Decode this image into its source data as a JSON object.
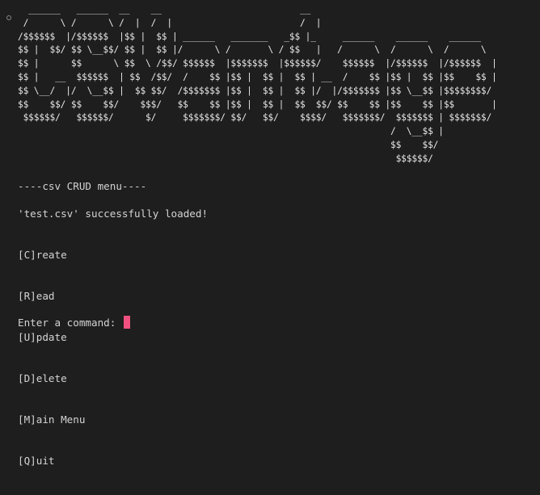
{
  "terminal": {
    "banner_lines": [
      "  ______   ______  __    __                          __",
      " /      \\ /      \\ /  |  /  |                        /  |",
      "/$$$$$$  |/$$$$$$  |$$ |  $$ | ______   _______   _$$ |_     ______    ______    ______",
      "$$ |  $$/ $$ \\__$$/ $$ |  $$ |/      \\ /       \\ / $$   |   /      \\  /      \\  /      \\",
      "$$ |      $$      \\ $$  \\ /$$/ $$$$$$  |$$$$$$$  |$$$$$$/    $$$$$$  |/$$$$$$  |/$$$$$$  |",
      "$$ |   __  $$$$$$  | $$  /$$/  /    $$ |$$ |  $$ |  $$ | __  /    $$ |$$ |  $$ |$$    $$ |",
      "$$ \\__/  |/  \\__$$ |  $$ $$/  /$$$$$$$ |$$ |  $$ |  $$ |/  |/$$$$$$$ |$$ \\__$$ |$$$$$$$$/",
      "$$    $$/ $$    $$/    $$$/   $$    $$ |$$ |  $$ |  $$  $$/ $$    $$ |$$    $$ |$$       |",
      " $$$$$$/   $$$$$$/      $/     $$$$$$$/ $$/   $$/    $$$$/   $$$$$$$/  $$$$$$$ | $$$$$$$/",
      "                                                                      /  \\__$$ |",
      "                                                                      $$    $$/",
      "                                                                       $$$$$$/"
    ],
    "menu_title": "----csv CRUD menu----",
    "load_status": "'test.csv' successfully loaded!",
    "menu_items": [
      "[C]reate",
      "[R]ead",
      "[U]pdate",
      "[D]elete",
      "[M]ain Menu",
      "[Q]uit"
    ],
    "prompt": "Enter a command: ",
    "colors": {
      "background": "#1e1e1e",
      "text": "#d4d4d4",
      "cursor": "#f0507f"
    }
  }
}
